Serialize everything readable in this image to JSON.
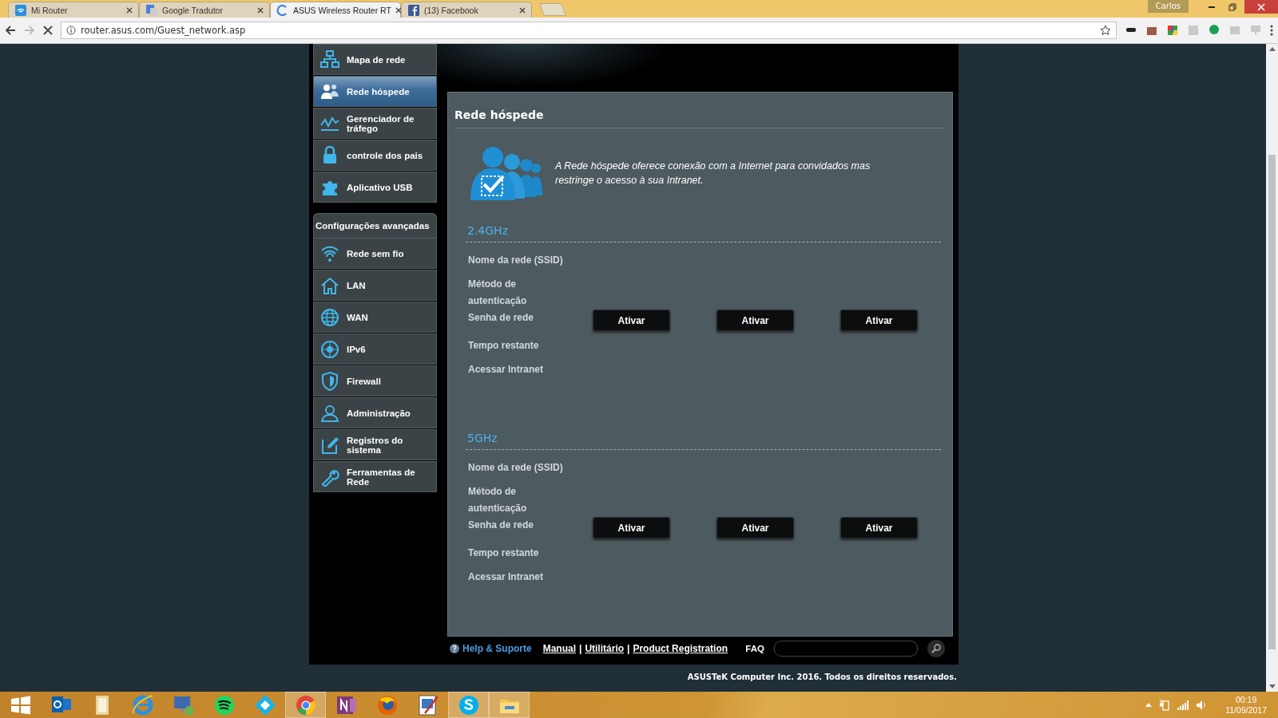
{
  "browser": {
    "profile": "Carlos",
    "url": "router.asus.com/Guest_network.asp",
    "tabs": [
      {
        "title": "Mi Router",
        "kind": "wifi",
        "selected": false
      },
      {
        "title": "Google Tradutor",
        "kind": "translate",
        "selected": false
      },
      {
        "title": "ASUS Wireless Router RT",
        "kind": "loading",
        "selected": true
      },
      {
        "title": "(13) Facebook",
        "kind": "social",
        "selected": false
      }
    ]
  },
  "sidebar": {
    "general": [
      {
        "label": "Mapa de rede",
        "kind": "map",
        "selected": false
      },
      {
        "label": "Rede hóspede",
        "kind": "guests",
        "selected": true
      },
      {
        "label": "Gerenciador de tráfego",
        "kind": "traffic",
        "selected": false
      },
      {
        "label": "controle dos pais",
        "kind": "lock",
        "selected": false
      },
      {
        "label": "Aplicativo USB",
        "kind": "puzzle",
        "selected": false
      }
    ],
    "advanced_title": "Configurações avançadas",
    "advanced": [
      {
        "label": "Rede sem fio",
        "kind": "wifi",
        "selected": false
      },
      {
        "label": "LAN",
        "kind": "home",
        "selected": false
      },
      {
        "label": "WAN",
        "kind": "globe",
        "selected": false
      },
      {
        "label": "IPv6",
        "kind": "globe6",
        "selected": false
      },
      {
        "label": "Firewall",
        "kind": "shield",
        "selected": false
      },
      {
        "label": "Administração",
        "kind": "person",
        "selected": false
      },
      {
        "label": "Registros do sistema",
        "kind": "edit",
        "selected": false
      },
      {
        "label": "Ferramentas de Rede",
        "kind": "wrench",
        "selected": false
      }
    ]
  },
  "panel": {
    "title": "Rede hóspede",
    "description": "A Rede hóspede oferece conexão com a Internet para convidados mas restringe o acesso à sua Intranet.",
    "bands": [
      {
        "name": "2.4GHz",
        "rows": [
          {
            "label": "Nome da rede (SSID)",
            "kind": "text"
          },
          {
            "label": "Método de autenticação",
            "kind": "text"
          },
          {
            "label": "Senha de rede",
            "kind": "buttons",
            "buttons": [
              "Ativar",
              "Ativar",
              "Ativar"
            ]
          },
          {
            "label": "Tempo restante",
            "kind": "text"
          },
          {
            "label": "Acessar Intranet",
            "kind": "text"
          }
        ]
      },
      {
        "name": "5GHz",
        "rows": [
          {
            "label": "Nome da rede (SSID)",
            "kind": "text"
          },
          {
            "label": "Método de autenticação",
            "kind": "text"
          },
          {
            "label": "Senha de rede",
            "kind": "buttons",
            "buttons": [
              "Ativar",
              "Ativar",
              "Ativar"
            ]
          },
          {
            "label": "Tempo restante",
            "kind": "text"
          },
          {
            "label": "Acessar Intranet",
            "kind": "text"
          }
        ]
      }
    ]
  },
  "footer": {
    "help": "Help & Suporte",
    "links": [
      "Manual",
      "Utilitário",
      "Product Registration"
    ],
    "separators": [
      "|",
      "|"
    ],
    "faq": "FAQ",
    "copyright": "ASUSTeK Computer Inc. 2016. Todos os direitos reservados."
  },
  "taskbar": {
    "apps": [
      {
        "kind": "windows",
        "selected": false
      },
      {
        "kind": "mail",
        "selected": false
      },
      {
        "kind": "folder",
        "selected": false
      },
      {
        "kind": "ie",
        "selected": false
      },
      {
        "kind": "remote",
        "selected": false
      },
      {
        "kind": "spotify",
        "selected": false
      },
      {
        "kind": "kodi",
        "selected": false
      },
      {
        "kind": "chrome",
        "selected": true
      },
      {
        "kind": "onenote",
        "selected": false
      },
      {
        "kind": "firefox",
        "selected": false
      },
      {
        "kind": "paint",
        "selected": false
      },
      {
        "kind": "skype",
        "selected": true
      },
      {
        "kind": "explorer",
        "selected": true
      }
    ],
    "time": "00:19",
    "date": "11/09/2017"
  }
}
